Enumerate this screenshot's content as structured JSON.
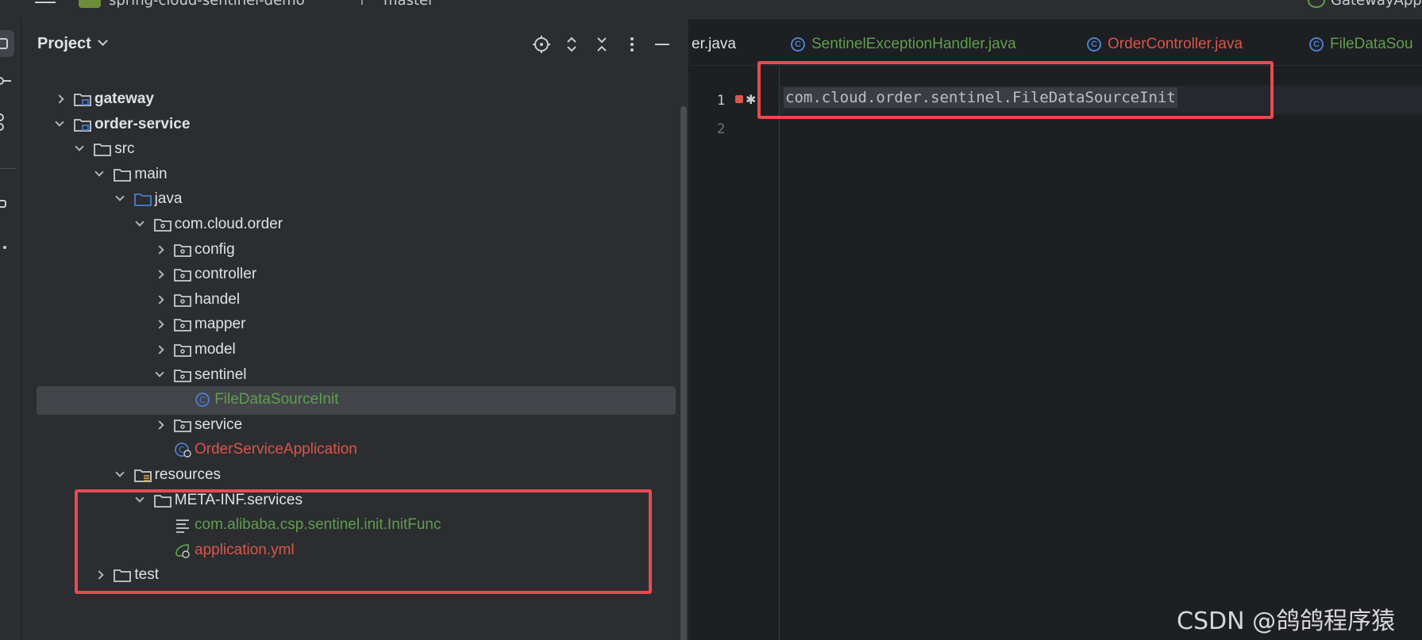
{
  "topbar": {
    "project_name": "spring-cloud-sentinel-demo",
    "branch": "master",
    "run_config": "GatewayApp"
  },
  "panel": {
    "title": "Project",
    "actions": [
      "locate-icon",
      "expand-all-icon",
      "collapse-all-icon",
      "more-icon",
      "hide-icon"
    ]
  },
  "tree": [
    {
      "label": "gateway",
      "style": "bold",
      "icon": "module-folder-icon",
      "state": "collapsed"
    },
    {
      "label": "order-service",
      "style": "bold",
      "icon": "module-folder-icon",
      "state": "expanded"
    },
    {
      "label": "src",
      "style": "norm",
      "icon": "folder-icon",
      "state": "expanded"
    },
    {
      "label": "main",
      "style": "norm",
      "icon": "folder-icon",
      "state": "expanded"
    },
    {
      "label": "java",
      "style": "norm",
      "icon": "source-folder-icon",
      "state": "expanded"
    },
    {
      "label": "com.cloud.order",
      "style": "norm",
      "icon": "package-icon",
      "state": "expanded"
    },
    {
      "label": "config",
      "style": "norm",
      "icon": "package-icon",
      "state": "collapsed"
    },
    {
      "label": "controller",
      "style": "norm",
      "icon": "package-icon",
      "state": "collapsed"
    },
    {
      "label": "handel",
      "style": "norm",
      "icon": "package-icon",
      "state": "collapsed"
    },
    {
      "label": "mapper",
      "style": "norm",
      "icon": "package-icon",
      "state": "collapsed"
    },
    {
      "label": "model",
      "style": "norm",
      "icon": "package-icon",
      "state": "collapsed"
    },
    {
      "label": "sentinel",
      "style": "norm",
      "icon": "package-icon",
      "state": "expanded"
    },
    {
      "label": "FileDataSourceInit",
      "style": "green",
      "icon": "class-icon",
      "state": "leaf",
      "selected": true
    },
    {
      "label": "service",
      "style": "norm",
      "icon": "package-icon",
      "state": "collapsed"
    },
    {
      "label": "OrderServiceApplication",
      "style": "red",
      "icon": "spring-class-icon",
      "state": "leaf"
    },
    {
      "label": "resources",
      "style": "norm",
      "icon": "resources-folder-icon",
      "state": "expanded"
    },
    {
      "label": "META-INF.services",
      "style": "norm",
      "icon": "folder-icon",
      "state": "expanded"
    },
    {
      "label": "com.alibaba.csp.sentinel.init.InitFunc",
      "style": "green",
      "icon": "text-file-icon",
      "state": "leaf"
    },
    {
      "label": "application.yml",
      "style": "red",
      "icon": "spring-config-icon",
      "state": "leaf"
    },
    {
      "label": "test",
      "style": "norm",
      "icon": "folder-icon",
      "state": "collapsed"
    }
  ],
  "editor": {
    "tabs": [
      {
        "label": "er.java",
        "color": "#dfe1e5",
        "icon": false
      },
      {
        "label": "SentinelExceptionHandler.java",
        "color": "#5f9e4f",
        "icon": true
      },
      {
        "label": "OrderController.java",
        "color": "#d9564a",
        "icon": true
      },
      {
        "label": "FileDataSou",
        "color": "#5f9e4f",
        "icon": true
      }
    ],
    "line_numbers": [
      "1",
      "2"
    ],
    "code_line": "com.cloud.order.sentinel.FileDataSourceInit"
  },
  "watermark": "CSDN @鸽鸽程序猿",
  "colors": {
    "accent_red_box": "#e84a50",
    "green_file": "#5f9e4f",
    "red_file": "#d9564a",
    "selection": "#43454a"
  }
}
